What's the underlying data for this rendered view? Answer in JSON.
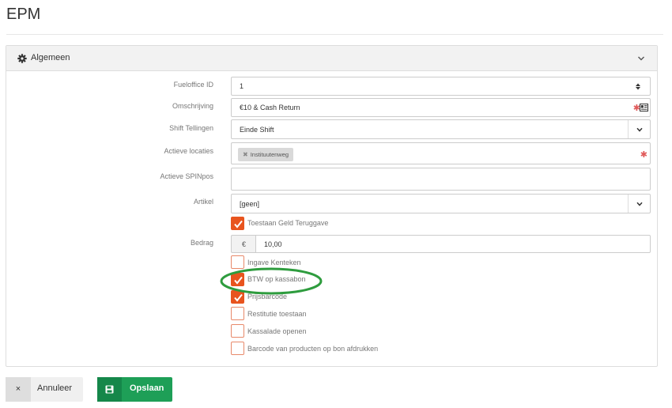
{
  "page": {
    "title": "EPM"
  },
  "panel": {
    "title": "Algemeen",
    "header_icon": "gear-icon",
    "collapse_icon": "chevron-down-icon"
  },
  "fields": {
    "fueloffice_id": {
      "label": "Fueloffice ID",
      "value": "1"
    },
    "omschrijving": {
      "label": "Omschrijving",
      "value": "€10 & Cash Return"
    },
    "shift_tellingen": {
      "label": "Shift Tellingen",
      "value": "Einde Shift"
    },
    "actieve_locaties": {
      "label": "Actieve locaties",
      "tags": [
        "Instituutenweg"
      ]
    },
    "actieve_spinpos": {
      "label": "Actieve SPINpos",
      "value": ""
    },
    "artikel": {
      "label": "Artikel",
      "value": "[geen]"
    },
    "bedrag": {
      "label": "Bedrag",
      "currency": "€",
      "value": "10,00"
    }
  },
  "checkboxes": [
    {
      "label": "Toestaan Geld Teruggave",
      "checked": true
    },
    {
      "label": "Ingave Kenteken",
      "checked": false
    },
    {
      "label": "BTW op kassabon",
      "checked": true
    },
    {
      "label": "Prijsbarcode",
      "checked": true
    },
    {
      "label": "Restitutie toestaan",
      "checked": false
    },
    {
      "label": "Kassalade openen",
      "checked": false
    },
    {
      "label": "Barcode van producten op bon afdrukken",
      "checked": false
    }
  ],
  "buttons": {
    "cancel_label": "Annuleer",
    "cancel_icon": "×",
    "save_label": "Opslaan"
  },
  "colors": {
    "accent_checkbox": "#e8541e",
    "save_button": "#1e9f57",
    "highlight": "#2e9c3e"
  }
}
